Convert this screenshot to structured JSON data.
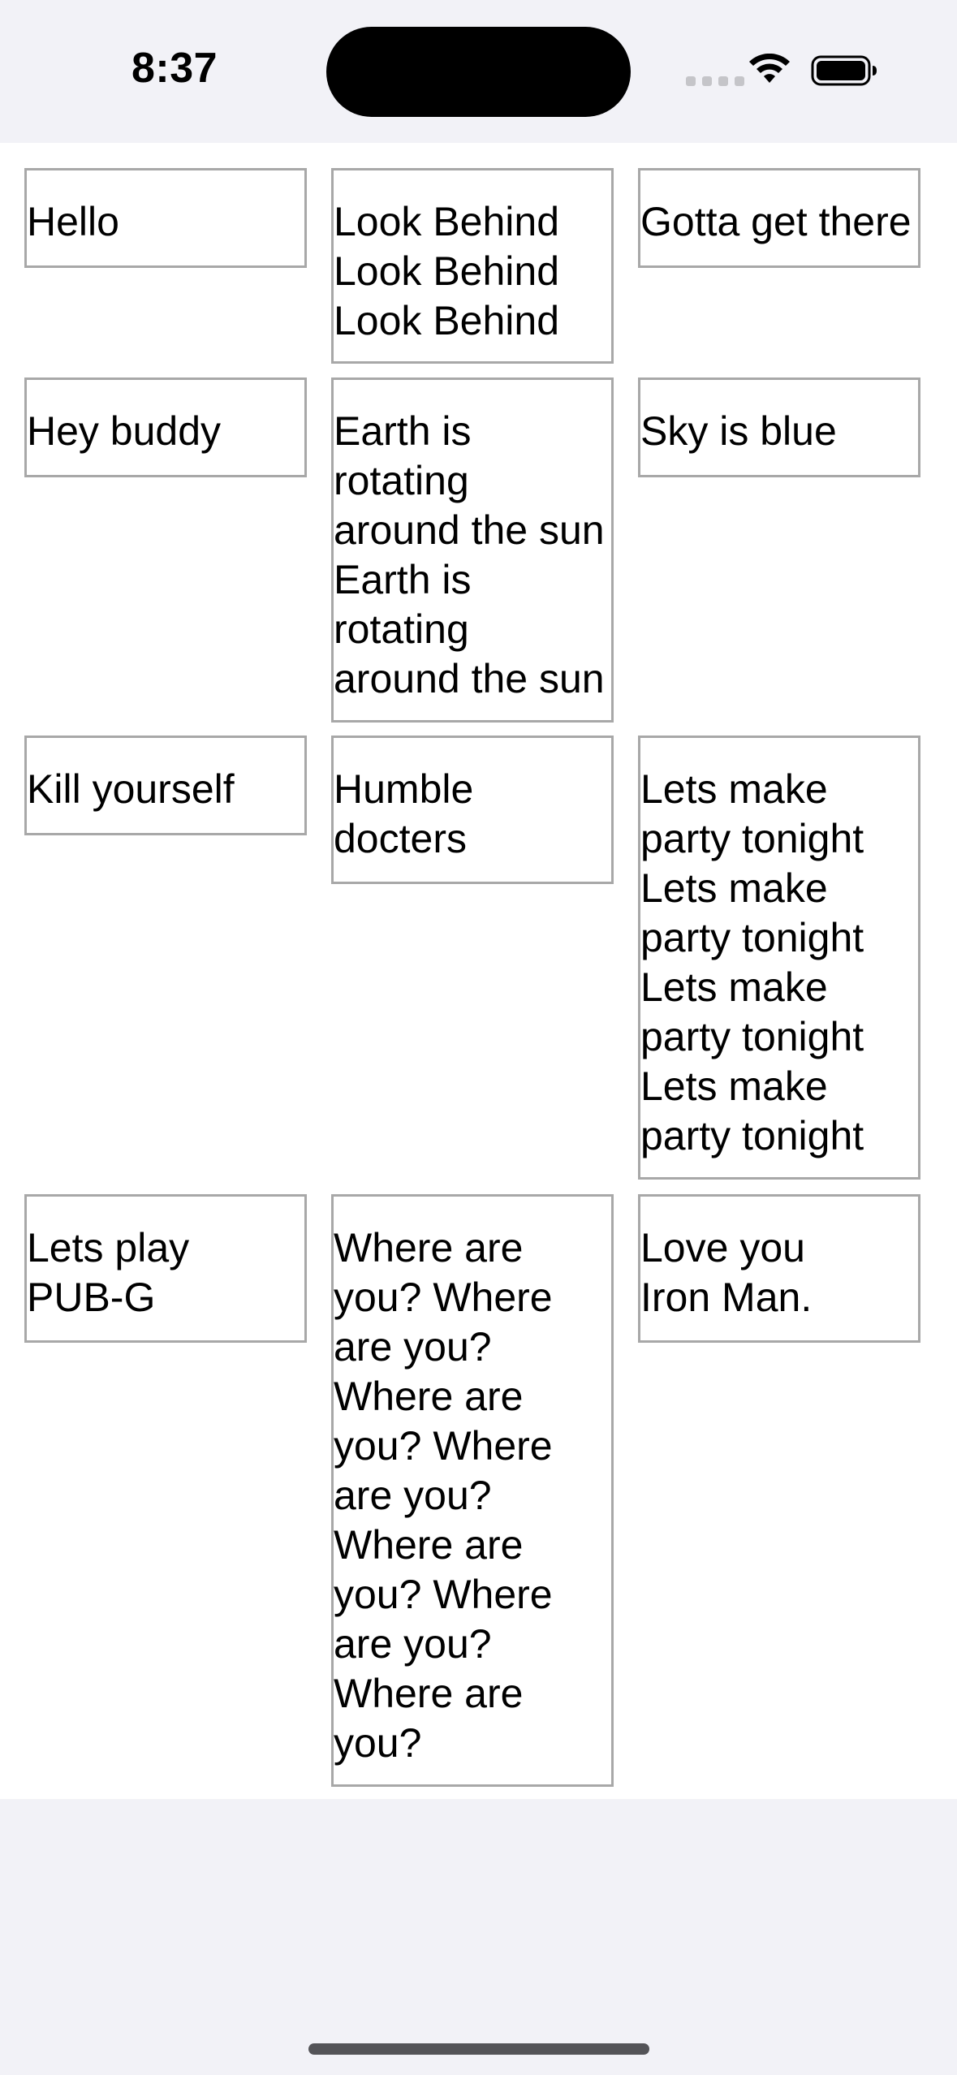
{
  "status_bar": {
    "time": "8:37",
    "icons": [
      "cellular-signal-icon",
      "wifi-icon",
      "battery-icon"
    ]
  },
  "grid": {
    "rows": [
      [
        "Hello",
        "Look Behind\nLook Behind\nLook Behind",
        "Gotta get there"
      ],
      [
        "Hey buddy",
        "Earth is\nrotating\naround the sun\nEarth is\nrotating\naround the sun",
        "Sky is blue"
      ],
      [
        "Kill yourself",
        "Humble\ndocters",
        "Lets make\nparty tonight\nLets make\nparty tonight\nLets make\nparty tonight\nLets make\nparty tonight"
      ],
      [
        "Lets play\nPUB-G",
        "Where are\nyou? Where\nare you?\nWhere are\nyou? Where\nare you?\nWhere are\nyou? Where\nare you?\nWhere are\nyou?",
        "Love you\nIron Man."
      ]
    ]
  }
}
